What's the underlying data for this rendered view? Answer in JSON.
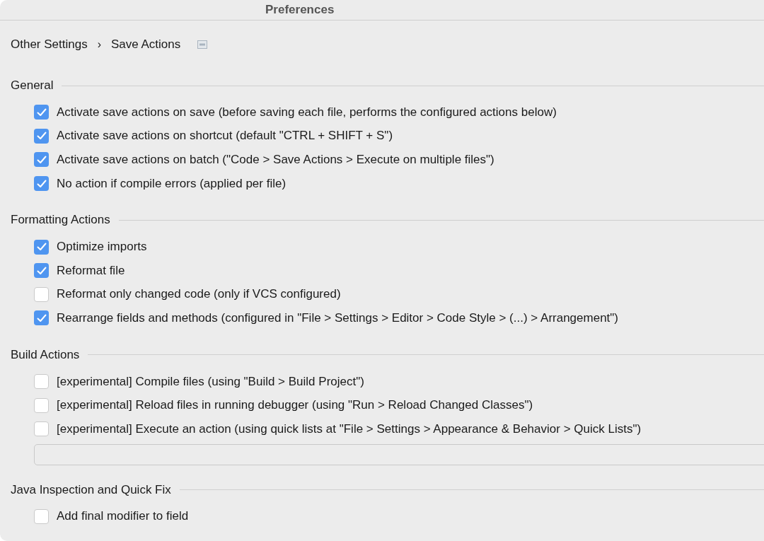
{
  "window": {
    "title": "Preferences"
  },
  "breadcrumb": {
    "items": [
      "Other Settings",
      "Save Actions"
    ],
    "separator": "›"
  },
  "sections": [
    {
      "title": "General",
      "items": [
        {
          "kind": "checkbox",
          "label": "Activate save actions on save (before saving each file, performs the configured actions below)",
          "checked": true
        },
        {
          "kind": "checkbox",
          "label": "Activate save actions on shortcut (default \"CTRL + SHIFT + S\")",
          "checked": true
        },
        {
          "kind": "checkbox",
          "label": "Activate save actions on batch (\"Code > Save Actions > Execute on multiple files\")",
          "checked": true
        },
        {
          "kind": "checkbox",
          "label": "No action if compile errors (applied per file)",
          "checked": true
        }
      ]
    },
    {
      "title": "Formatting Actions",
      "items": [
        {
          "kind": "checkbox",
          "label": "Optimize imports",
          "checked": true
        },
        {
          "kind": "checkbox",
          "label": "Reformat file",
          "checked": true
        },
        {
          "kind": "checkbox",
          "label": "Reformat only changed code (only if VCS configured)",
          "checked": false
        },
        {
          "kind": "checkbox",
          "label": "Rearrange fields and methods (configured in \"File > Settings > Editor > Code Style > (...) > Arrangement\")",
          "checked": true
        }
      ]
    },
    {
      "title": "Build Actions",
      "items": [
        {
          "kind": "checkbox",
          "label": "[experimental] Compile files (using \"Build > Build Project\")",
          "checked": false
        },
        {
          "kind": "checkbox",
          "label": "[experimental] Reload files in running debugger (using \"Run > Reload Changed Classes\")",
          "checked": false
        },
        {
          "kind": "checkbox",
          "label": "[experimental] Execute an action (using quick lists at \"File > Settings > Appearance & Behavior > Quick Lists\")",
          "checked": false
        },
        {
          "kind": "field"
        }
      ]
    },
    {
      "title": "Java Inspection and Quick Fix",
      "items": [
        {
          "kind": "checkbox",
          "label": "Add final modifier to field",
          "checked": false
        }
      ]
    }
  ]
}
